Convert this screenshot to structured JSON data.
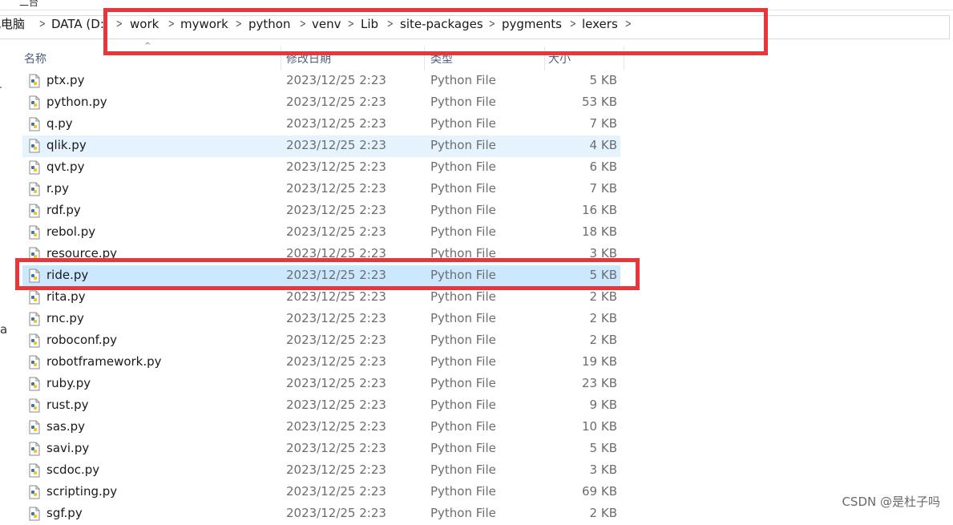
{
  "top_fragment": "二台",
  "breadcrumbs": [
    {
      "label": "此电脑"
    },
    {
      "label": "DATA (D:"
    },
    {
      "label": "work"
    },
    {
      "label": "mywork"
    },
    {
      "label": "python"
    },
    {
      "label": "venv"
    },
    {
      "label": "Lib"
    },
    {
      "label": "site-packages"
    },
    {
      "label": "pygments"
    },
    {
      "label": "lexers"
    }
  ],
  "columns": {
    "name": "名称",
    "date": "修改日期",
    "type": "类型",
    "size": "大小"
  },
  "left_edge_char": "a",
  "files": [
    {
      "name": "ptx.py",
      "date": "2023/12/25 2:23",
      "type": "Python File",
      "size": "5 KB"
    },
    {
      "name": "python.py",
      "date": "2023/12/25 2:23",
      "type": "Python File",
      "size": "53 KB"
    },
    {
      "name": "q.py",
      "date": "2023/12/25 2:23",
      "type": "Python File",
      "size": "7 KB"
    },
    {
      "name": "qlik.py",
      "date": "2023/12/25 2:23",
      "type": "Python File",
      "size": "4 KB"
    },
    {
      "name": "qvt.py",
      "date": "2023/12/25 2:23",
      "type": "Python File",
      "size": "6 KB"
    },
    {
      "name": "r.py",
      "date": "2023/12/25 2:23",
      "type": "Python File",
      "size": "7 KB"
    },
    {
      "name": "rdf.py",
      "date": "2023/12/25 2:23",
      "type": "Python File",
      "size": "16 KB"
    },
    {
      "name": "rebol.py",
      "date": "2023/12/25 2:23",
      "type": "Python File",
      "size": "18 KB"
    },
    {
      "name": "resource.py",
      "date": "2023/12/25 2:23",
      "type": "Python File",
      "size": "3 KB"
    },
    {
      "name": "ride.py",
      "date": "2023/12/25 2:23",
      "type": "Python File",
      "size": "5 KB"
    },
    {
      "name": "rita.py",
      "date": "2023/12/25 2:23",
      "type": "Python File",
      "size": "2 KB"
    },
    {
      "name": "rnc.py",
      "date": "2023/12/25 2:23",
      "type": "Python File",
      "size": "2 KB"
    },
    {
      "name": "roboconf.py",
      "date": "2023/12/25 2:23",
      "type": "Python File",
      "size": "2 KB"
    },
    {
      "name": "robotframework.py",
      "date": "2023/12/25 2:23",
      "type": "Python File",
      "size": "19 KB"
    },
    {
      "name": "ruby.py",
      "date": "2023/12/25 2:23",
      "type": "Python File",
      "size": "23 KB"
    },
    {
      "name": "rust.py",
      "date": "2023/12/25 2:23",
      "type": "Python File",
      "size": "9 KB"
    },
    {
      "name": "sas.py",
      "date": "2023/12/25 2:23",
      "type": "Python File",
      "size": "10 KB"
    },
    {
      "name": "savi.py",
      "date": "2023/12/25 2:23",
      "type": "Python File",
      "size": "5 KB"
    },
    {
      "name": "scdoc.py",
      "date": "2023/12/25 2:23",
      "type": "Python File",
      "size": "3 KB"
    },
    {
      "name": "scripting.py",
      "date": "2023/12/25 2:23",
      "type": "Python File",
      "size": "69 KB"
    },
    {
      "name": "sgf.py",
      "date": "2023/12/25 2:23",
      "type": "Python File",
      "size": "2 KB"
    }
  ],
  "hovered_file": "qlik.py",
  "selected_file": "ride.py",
  "annotation_color": "#e8373a",
  "watermark": "CSDN @是杜子吗"
}
